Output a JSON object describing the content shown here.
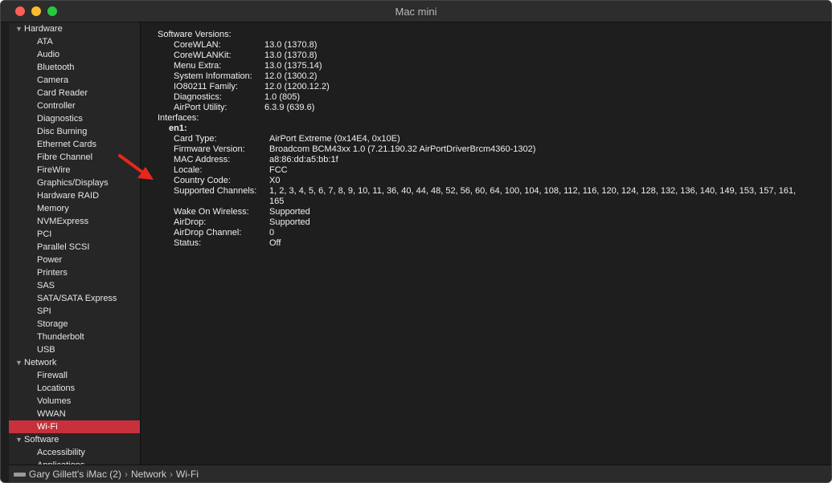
{
  "window": {
    "title": "Mac mini"
  },
  "sidebar": [
    {
      "type": "group",
      "label": "Hardware"
    },
    {
      "type": "child",
      "label": "ATA"
    },
    {
      "type": "child",
      "label": "Audio"
    },
    {
      "type": "child",
      "label": "Bluetooth"
    },
    {
      "type": "child",
      "label": "Camera"
    },
    {
      "type": "child",
      "label": "Card Reader"
    },
    {
      "type": "child",
      "label": "Controller"
    },
    {
      "type": "child",
      "label": "Diagnostics"
    },
    {
      "type": "child",
      "label": "Disc Burning"
    },
    {
      "type": "child",
      "label": "Ethernet Cards"
    },
    {
      "type": "child",
      "label": "Fibre Channel"
    },
    {
      "type": "child",
      "label": "FireWire"
    },
    {
      "type": "child",
      "label": "Graphics/Displays"
    },
    {
      "type": "child",
      "label": "Hardware RAID"
    },
    {
      "type": "child",
      "label": "Memory"
    },
    {
      "type": "child",
      "label": "NVMExpress"
    },
    {
      "type": "child",
      "label": "PCI"
    },
    {
      "type": "child",
      "label": "Parallel SCSI"
    },
    {
      "type": "child",
      "label": "Power"
    },
    {
      "type": "child",
      "label": "Printers"
    },
    {
      "type": "child",
      "label": "SAS"
    },
    {
      "type": "child",
      "label": "SATA/SATA Express"
    },
    {
      "type": "child",
      "label": "SPI"
    },
    {
      "type": "child",
      "label": "Storage"
    },
    {
      "type": "child",
      "label": "Thunderbolt"
    },
    {
      "type": "child",
      "label": "USB"
    },
    {
      "type": "group",
      "label": "Network"
    },
    {
      "type": "child",
      "label": "Firewall"
    },
    {
      "type": "child",
      "label": "Locations"
    },
    {
      "type": "child",
      "label": "Volumes"
    },
    {
      "type": "child",
      "label": "WWAN"
    },
    {
      "type": "child",
      "label": "Wi-Fi",
      "selected": true
    },
    {
      "type": "group",
      "label": "Software"
    },
    {
      "type": "child",
      "label": "Accessibility"
    },
    {
      "type": "child",
      "label": "Applications"
    }
  ],
  "content": {
    "software_versions_label": "Software Versions:",
    "software_versions": [
      {
        "key": "CoreWLAN:",
        "value": "13.0 (1370.8)"
      },
      {
        "key": "CoreWLANKit:",
        "value": "13.0 (1370.8)"
      },
      {
        "key": "Menu Extra:",
        "value": "13.0 (1375.14)"
      },
      {
        "key": "System Information:",
        "value": "12.0 (1300.2)"
      },
      {
        "key": "IO80211 Family:",
        "value": "12.0 (1200.12.2)"
      },
      {
        "key": "Diagnostics:",
        "value": "1.0 (805)"
      },
      {
        "key": "AirPort Utility:",
        "value": "6.3.9 (639.6)"
      }
    ],
    "interfaces_label": "Interfaces:",
    "interface_name": "en1:",
    "interface_props": [
      {
        "key": "Card Type:",
        "value": "AirPort Extreme  (0x14E4, 0x10E)"
      },
      {
        "key": "Firmware Version:",
        "value": "Broadcom BCM43xx 1.0 (7.21.190.32 AirPortDriverBrcm4360-1302)"
      },
      {
        "key": "MAC Address:",
        "value": "a8:86:dd:a5:bb:1f"
      },
      {
        "key": "Locale:",
        "value": "FCC"
      },
      {
        "key": "Country Code:",
        "value": "X0"
      },
      {
        "key": "Supported Channels:",
        "value": "1, 2, 3, 4, 5, 6, 7, 8, 9, 10, 11, 36, 40, 44, 48, 52, 56, 60, 64, 100, 104, 108, 112, 116, 120, 124, 128, 132, 136, 140, 149, 153, 157, 161,",
        "value2": "165"
      },
      {
        "key": "Wake On Wireless:",
        "value": "Supported"
      },
      {
        "key": "AirDrop:",
        "value": "Supported"
      },
      {
        "key": "AirDrop Channel:",
        "value": "0"
      },
      {
        "key": "Status:",
        "value": "Off"
      }
    ]
  },
  "statusbar": {
    "computer": "Gary Gillett's iMac (2)",
    "section": "Network",
    "item": "Wi-Fi"
  },
  "colors": {
    "selection": "#c8313b",
    "annotation_arrow": "#e8271b"
  },
  "icons": [
    "close-button",
    "minimize-button",
    "zoom-button",
    "disclosure-triangle-icon",
    "computer-icon",
    "breadcrumb-chevron-icon",
    "annotation-arrow"
  ]
}
